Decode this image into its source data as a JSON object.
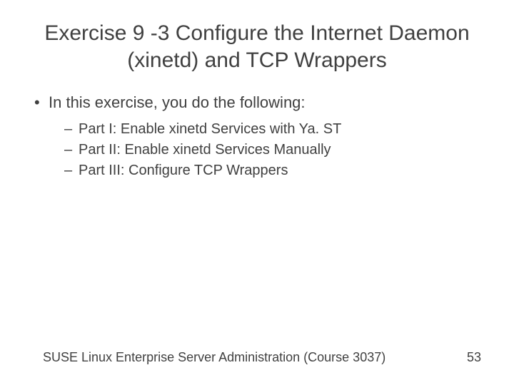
{
  "title": "Exercise 9 -3 Configure the Internet Daemon (xinetd) and TCP Wrappers",
  "intro": "In this exercise, you do the following:",
  "parts": [
    "Part I: Enable xinetd Services with Ya. ST",
    "Part II: Enable xinetd Services Manually",
    "Part III: Configure TCP Wrappers"
  ],
  "footer": {
    "course": "SUSE Linux Enterprise Server Administration (Course 3037)",
    "page": "53"
  }
}
